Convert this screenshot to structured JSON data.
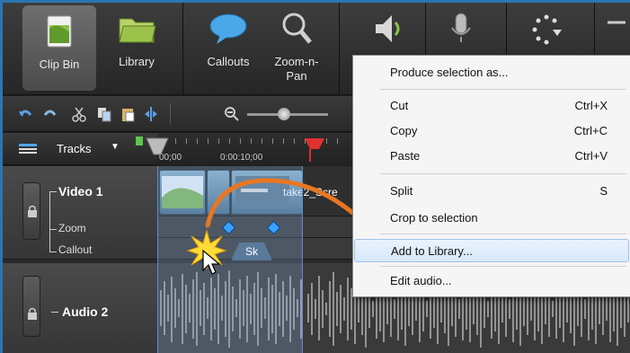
{
  "toolbar": {
    "tools": [
      {
        "label": "Clip Bin",
        "icon": "clip-bin-icon",
        "active": true
      },
      {
        "label": "Library",
        "icon": "library-folder-icon"
      },
      {
        "label": "Callouts",
        "icon": "callout-bubble-icon"
      },
      {
        "label": "Zoom-n-\nPan",
        "icon": "magnifier-icon"
      },
      {
        "label": "",
        "icon": "speaker-icon"
      },
      {
        "label": "",
        "icon": "microphone-icon"
      },
      {
        "label": "",
        "icon": "transitions-icon"
      },
      {
        "label": "",
        "icon": "more-icon"
      }
    ]
  },
  "tracks_bar": {
    "label": "Tracks",
    "times": [
      "00;00",
      "0:00:10;00"
    ]
  },
  "tracks": {
    "video": {
      "name": "Video 1",
      "subtracks": [
        "Zoom",
        "Callout"
      ],
      "clip_label": "take2_Scre"
    },
    "callout_clip_label": "Sk",
    "audio": {
      "name": "Audio 2"
    }
  },
  "context_menu": {
    "items": [
      {
        "label": "Produce selection as...",
        "shortcut": ""
      },
      {
        "label": "Cut",
        "shortcut": "Ctrl+X"
      },
      {
        "label": "Copy",
        "shortcut": "Ctrl+C"
      },
      {
        "label": "Paste",
        "shortcut": "Ctrl+V"
      },
      {
        "label": "Split",
        "shortcut": "S"
      },
      {
        "label": "Crop to selection",
        "shortcut": ""
      },
      {
        "label": "Add to Library...",
        "shortcut": ""
      },
      {
        "label": "Edit audio...",
        "shortcut": ""
      }
    ],
    "highlighted": "Add to Library..."
  },
  "colors": {
    "accent_orange": "#e87722",
    "selection_blue": "#5a8fd0",
    "frame_blue": "#2a76b3"
  }
}
